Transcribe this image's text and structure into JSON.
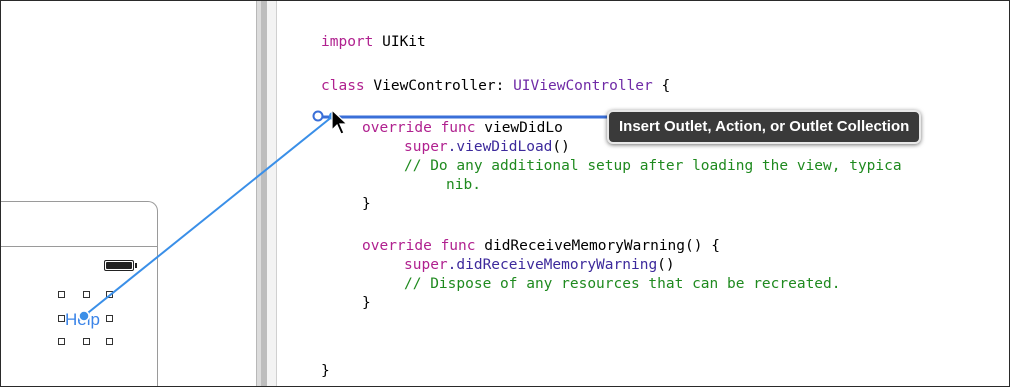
{
  "canvas": {
    "view_label": "Help"
  },
  "tooltip": {
    "text": "Insert Outlet, Action, or Outlet Collection"
  },
  "code": {
    "line1": {
      "kw": "import",
      "rest": " UIKit"
    },
    "line2": {
      "kw": "class",
      "name": " ViewController: ",
      "super": "UIViewController",
      "brace": " {"
    },
    "line3": {
      "kw1": "override",
      "kw2": "func",
      "rest": "viewDidLo"
    },
    "line4": {
      "kw": "super",
      "call": ".viewDidLoad",
      "rest": "()"
    },
    "line5": {
      "comment": "// Do any additional setup after loading the view, typica"
    },
    "line6": {
      "comment": "nib."
    },
    "line7": {
      "text": "}"
    },
    "line8": {
      "kw1": "override",
      "kw2": "func",
      "rest": "didReceiveMemoryWarning() {"
    },
    "line9": {
      "kw": "super",
      "call": ".didReceiveMemoryWarning",
      "rest": "()"
    },
    "line10": {
      "comment": "// Dispose of any resources that can be recreated."
    },
    "line11": {
      "text": "}"
    },
    "line12": {
      "text": "}"
    }
  },
  "colors": {
    "keyword": "#b0218f",
    "type": "#6f2aa6",
    "comment": "#1f8a1f",
    "connection_line": "#3a8fe8",
    "tooltip_bg": "#3a3a3a"
  },
  "icons": {
    "cursor": "arrow-cursor-icon",
    "battery": "battery-icon",
    "connection_endpoint": "connection-endpoint-icon"
  }
}
